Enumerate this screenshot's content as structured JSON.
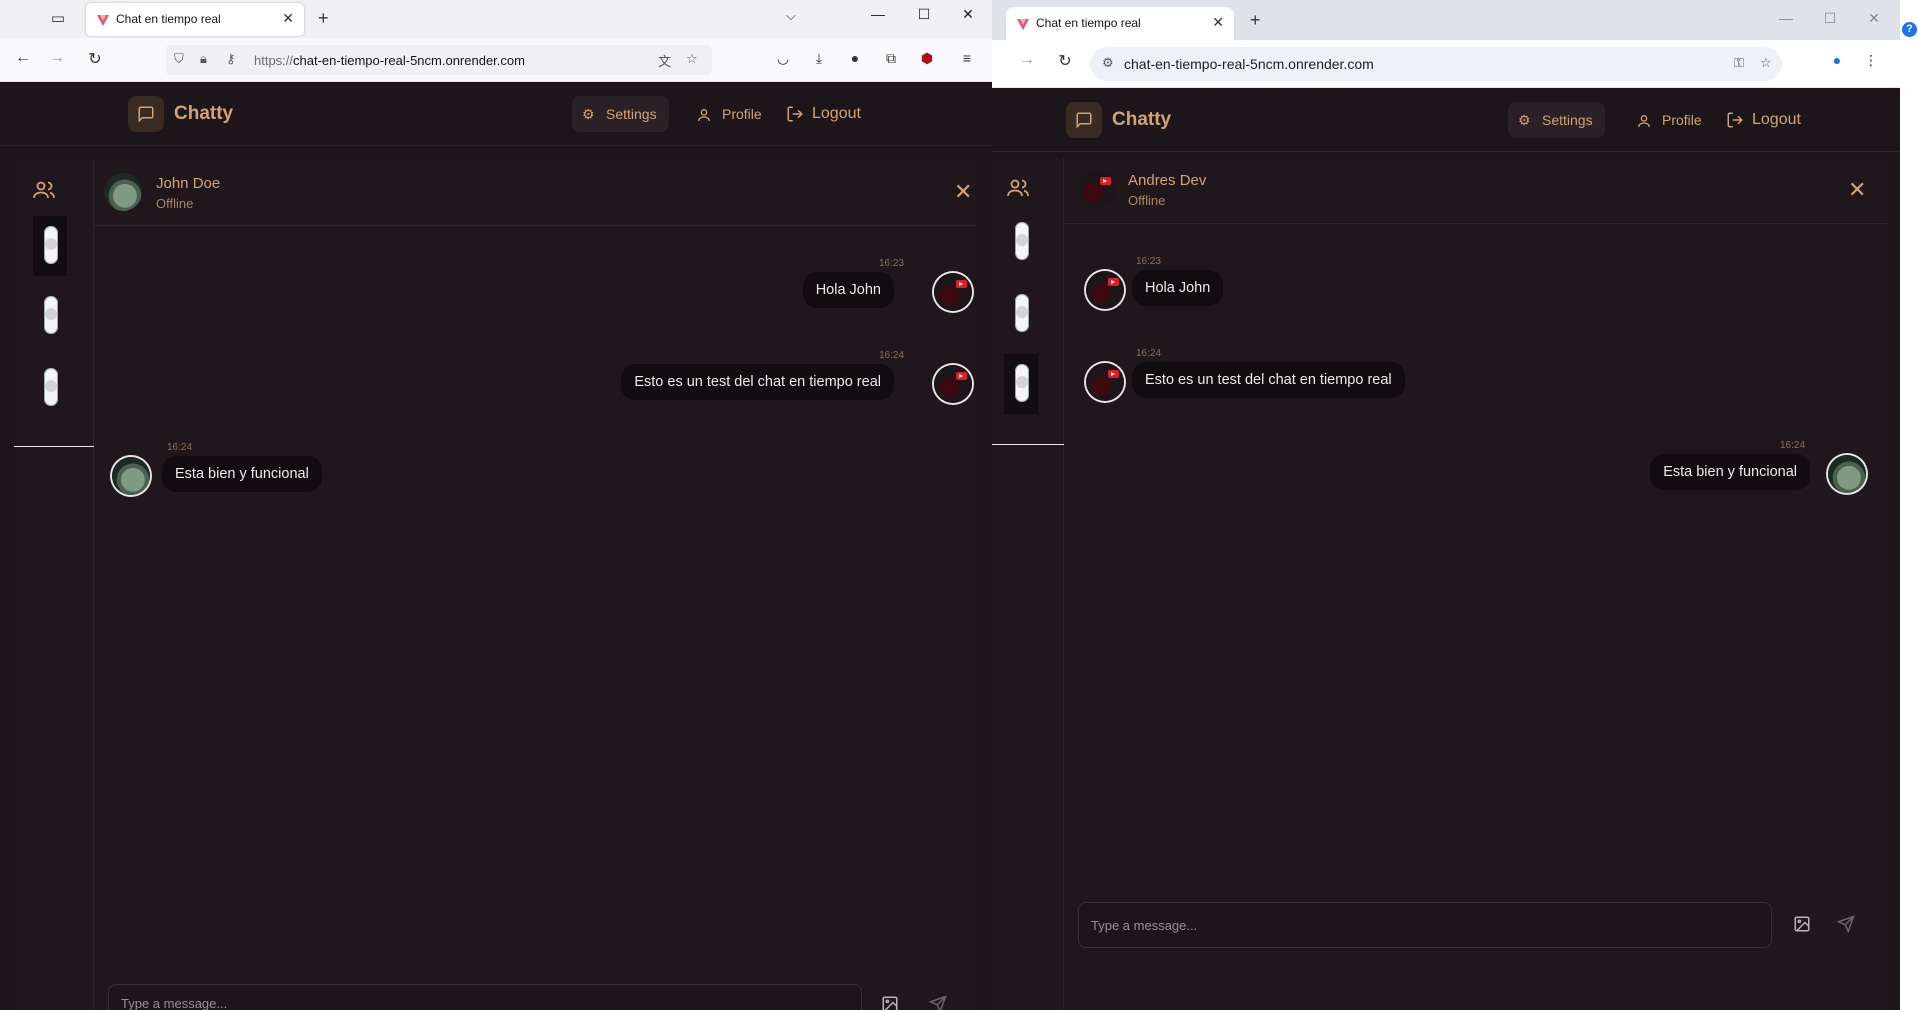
{
  "left_browser": {
    "tab_title": "Chat en tiempo real",
    "url_scheme": "https://",
    "url_host": "chat-en-tiempo-real-5ncm.onrender.com"
  },
  "right_browser": {
    "tab_title": "Chat en tiempo real",
    "url_host": "chat-en-tiempo-real-5ncm.onrender.com"
  },
  "app": {
    "brand": "Chatty",
    "nav": {
      "settings": "Settings",
      "profile": "Profile",
      "logout": "Logout"
    },
    "composer_placeholder": "Type a message..."
  },
  "left_chat": {
    "contact_name": "John Doe",
    "contact_status": "Offline",
    "messages": [
      {
        "time": "16:23",
        "text": "Hola John",
        "side": "right"
      },
      {
        "time": "16:24",
        "text": "Esto es un test del chat en tiempo real",
        "side": "right"
      },
      {
        "time": "16:24",
        "text": "Esta bien y funcional",
        "side": "left"
      }
    ]
  },
  "right_chat": {
    "contact_name": "Andres Dev",
    "contact_status": "Offline",
    "messages": [
      {
        "time": "16:23",
        "text": "Hola John",
        "side": "left"
      },
      {
        "time": "16:24",
        "text": "Esto es un test del chat en tiempo real",
        "side": "left"
      },
      {
        "time": "16:24",
        "text": "Esta bien y funcional",
        "side": "right"
      }
    ]
  },
  "icons": {
    "brand": "message-square-icon",
    "settings": "gear-icon",
    "profile": "user-icon",
    "logout": "logout-icon",
    "contacts": "users-icon",
    "close": "close-icon",
    "image": "image-icon",
    "send": "send-icon"
  },
  "colors": {
    "accent": "#d4a373",
    "background": "#1c1519",
    "bubble": "#110c0f"
  }
}
